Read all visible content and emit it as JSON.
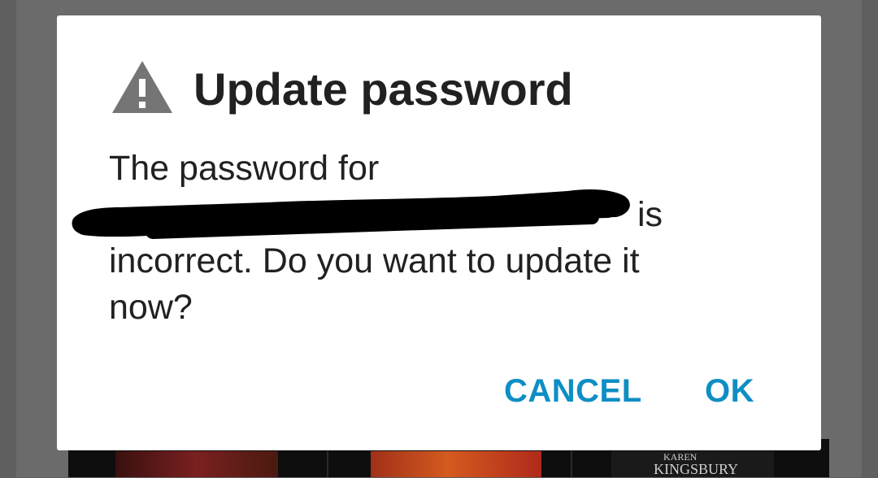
{
  "dialog": {
    "icon": "warning-icon",
    "title": "Update password",
    "message_line1": "The password for",
    "message_line2_suffix": "is",
    "message_line3": "incorrect. Do you want to update it",
    "message_line4": "now?",
    "cancel_label": "CANCEL",
    "ok_label": "OK"
  },
  "background": {
    "thumbnail_text_top": "KAREN",
    "thumbnail_text_bottom": "KINGSBURY"
  },
  "colors": {
    "accent": "#0e8ec4",
    "text": "#212121",
    "icon": "#757575",
    "scrim": "#5f5f5f"
  }
}
